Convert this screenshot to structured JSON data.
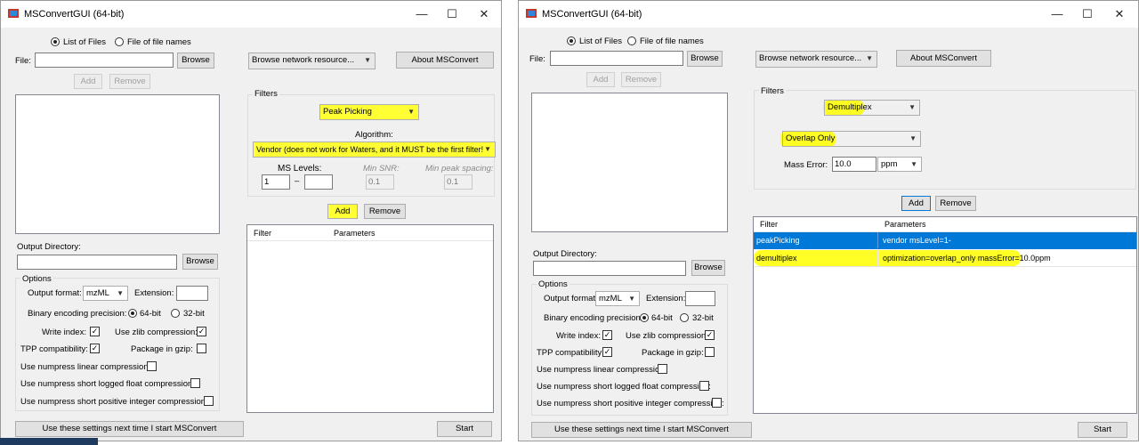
{
  "left": {
    "title": "MSConvertGUI (64-bit)",
    "radio_list_of_files": "List of Files",
    "radio_file_of_file_names": "File of file names",
    "file_label": "File:",
    "browse": "Browse",
    "add": "Add",
    "remove": "Remove",
    "browse_network": "Browse network resource...",
    "about": "About MSConvert",
    "filters_title": "Filters",
    "filter_selected": "Peak Picking",
    "algorithm_label": "Algorithm:",
    "algorithm_value": "Vendor (does not work for Waters, and it MUST be the first filter!",
    "ms_levels_label": "MS Levels:",
    "ms_level_from": "1",
    "ms_level_dash": "–",
    "ms_level_to": "",
    "min_snr_label": "Min SNR:",
    "min_snr_value": "0.1",
    "min_peak_label": "Min peak spacing:",
    "min_peak_value": "0.1",
    "filter_add": "Add",
    "filter_remove": "Remove",
    "col_filter": "Filter",
    "col_parameters": "Parameters",
    "output_dir_label": "Output Directory:",
    "output_browse": "Browse",
    "options_title": "Options",
    "output_format_label": "Output format:",
    "output_format_value": "mzML",
    "extension_label": "Extension:",
    "precision_label": "Binary encoding precision:",
    "precision_64": "64-bit",
    "precision_32": "32-bit",
    "write_index": "Write index:",
    "zlib": "Use zlib compression:",
    "tpp": "TPP compatibility:",
    "gzip": "Package in gzip:",
    "numpress_linear": "Use numpress linear compression:",
    "numpress_slof": "Use numpress short logged float compression:",
    "numpress_pic": "Use numpress short positive integer compression:",
    "use_settings": "Use these settings next time I start MSConvert",
    "start": "Start"
  },
  "right": {
    "title": "MSConvertGUI (64-bit)",
    "radio_list_of_files": "List of Files",
    "radio_file_of_file_names": "File of file names",
    "file_label": "File:",
    "browse": "Browse",
    "add": "Add",
    "remove": "Remove",
    "browse_network": "Browse network resource...",
    "about": "About MSConvert",
    "filters_title": "Filters",
    "filter_selected": "Demultiplex",
    "optimization_value": "Overlap Only",
    "mass_error_label": "Mass Error:",
    "mass_error_value": "10.0",
    "mass_error_unit": "ppm",
    "filter_add": "Add",
    "filter_remove": "Remove",
    "col_filter": "Filter",
    "col_parameters": "Parameters",
    "rows": [
      {
        "filter": "peakPicking",
        "parameters": "vendor msLevel=1-"
      },
      {
        "filter": "demultiplex",
        "parameters": "optimization=overlap_only massError=10.0ppm"
      }
    ],
    "output_dir_label": "Output Directory:",
    "output_browse": "Browse",
    "options_title": "Options",
    "output_format_label": "Output format:",
    "output_format_value": "mzML",
    "extension_label": "Extension:",
    "precision_label": "Binary encoding precision:",
    "precision_64": "64-bit",
    "precision_32": "32-bit",
    "write_index": "Write index:",
    "zlib": "Use zlib compression:",
    "tpp": "TPP compatibility:",
    "gzip": "Package in gzip:",
    "numpress_linear": "Use numpress linear compression:",
    "numpress_slof": "Use numpress short logged float compression:",
    "numpress_pic": "Use numpress short positive integer compression:",
    "use_settings": "Use these settings next time I start MSConvert",
    "start": "Start"
  },
  "window_controls": {
    "minimize": "—",
    "maximize": "☐",
    "close": "✕"
  },
  "icons": {
    "app": "app-icon",
    "minimize": "minimize-icon",
    "maximize": "maximize-icon",
    "close": "close-icon",
    "dropdown": "chevron-down-icon",
    "check": "checkmark-icon"
  },
  "colors": {
    "highlight": "#ffff33",
    "selection": "#0078d7",
    "window_bg": "#f0f0f0"
  }
}
